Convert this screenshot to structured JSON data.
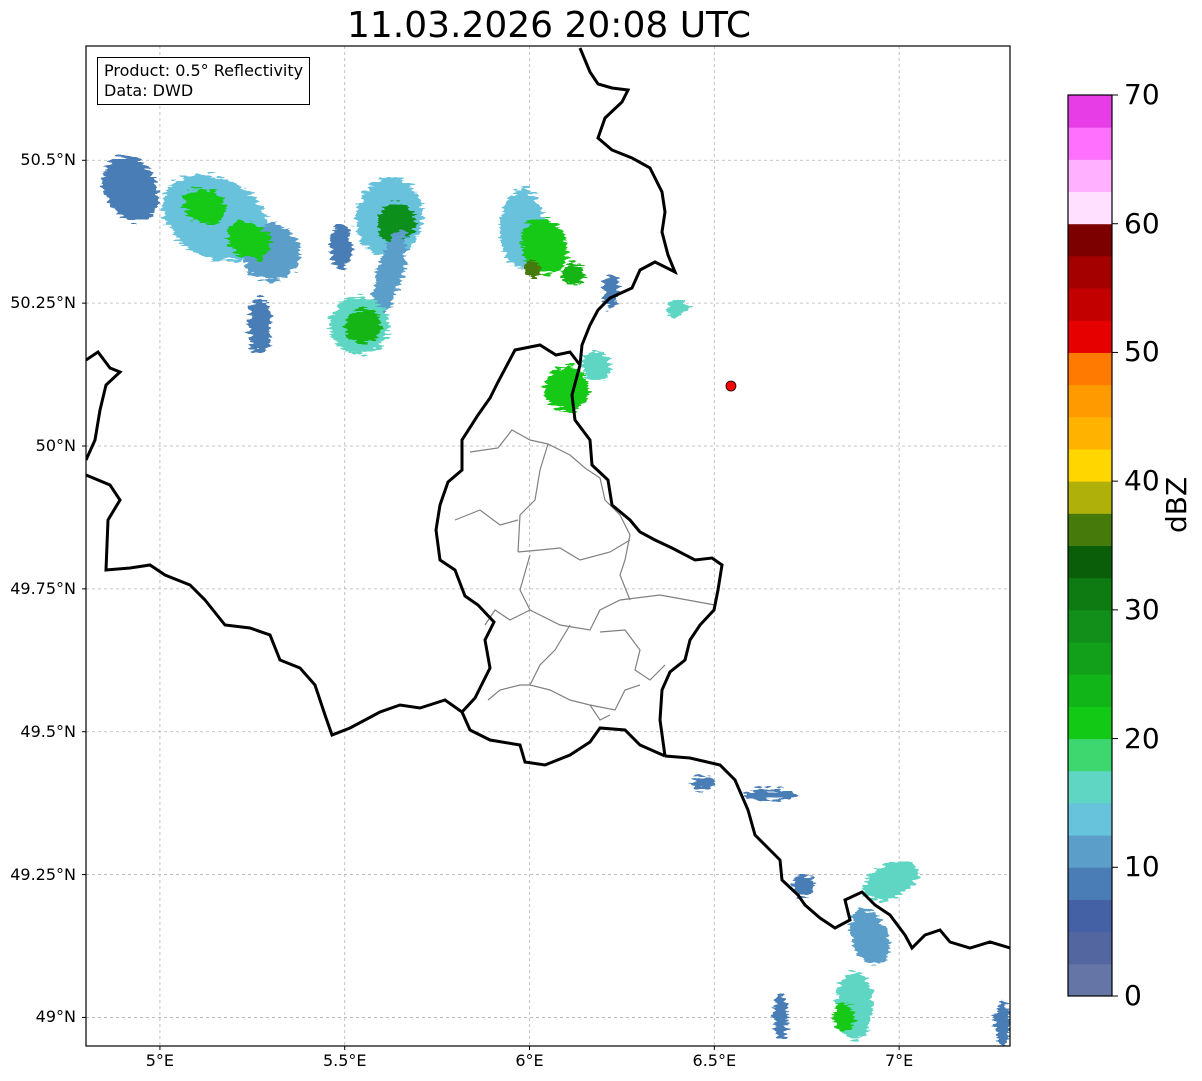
{
  "title": "11.03.2026 20:08 UTC",
  "info": {
    "product": "Product: 0.5° Reflectivity",
    "source": "Data: DWD"
  },
  "map": {
    "lon_range": [
      4.8,
      7.3
    ],
    "lat_range": [
      48.95,
      50.7
    ],
    "x_ticks": [
      {
        "value": 5.0,
        "label": "5°E"
      },
      {
        "value": 5.5,
        "label": "5.5°E"
      },
      {
        "value": 6.0,
        "label": "6°E"
      },
      {
        "value": 6.5,
        "label": "6.5°E"
      },
      {
        "value": 7.0,
        "label": "7°E"
      }
    ],
    "y_ticks": [
      {
        "value": 50.5,
        "label": "50.5°N"
      },
      {
        "value": 50.25,
        "label": "50.25°N"
      },
      {
        "value": 50.0,
        "label": "50°N"
      },
      {
        "value": 49.75,
        "label": "49.75°N"
      },
      {
        "value": 49.5,
        "label": "49.5°N"
      },
      {
        "value": 49.25,
        "label": "49.25°N"
      },
      {
        "value": 49.0,
        "label": "49°N"
      }
    ],
    "grid": true,
    "marker": {
      "lon": 6.545,
      "lat": 50.105,
      "color": "#ff0000"
    },
    "echo_cells": [
      {
        "lon": 4.92,
        "lat": 50.45,
        "rx": 0.07,
        "ry": 0.06,
        "angle": -25,
        "dbz": 9
      },
      {
        "lon": 5.15,
        "lat": 50.4,
        "rx": 0.15,
        "ry": 0.07,
        "angle": 25,
        "dbz": 14
      },
      {
        "lon": 5.3,
        "lat": 50.34,
        "rx": 0.08,
        "ry": 0.05,
        "angle": 20,
        "dbz": 12
      },
      {
        "lon": 5.12,
        "lat": 50.42,
        "rx": 0.06,
        "ry": 0.03,
        "angle": 25,
        "dbz": 22
      },
      {
        "lon": 5.24,
        "lat": 50.36,
        "rx": 0.06,
        "ry": 0.03,
        "angle": 25,
        "dbz": 20
      },
      {
        "lon": 5.27,
        "lat": 50.21,
        "rx": 0.03,
        "ry": 0.05,
        "angle": 0,
        "dbz": 9
      },
      {
        "lon": 5.62,
        "lat": 50.4,
        "rx": 0.09,
        "ry": 0.07,
        "angle": 10,
        "dbz": 14
      },
      {
        "lon": 5.64,
        "lat": 50.39,
        "rx": 0.05,
        "ry": 0.035,
        "angle": 10,
        "dbz": 28
      },
      {
        "lon": 5.62,
        "lat": 50.3,
        "rx": 0.035,
        "ry": 0.08,
        "angle": 15,
        "dbz": 12
      },
      {
        "lon": 5.54,
        "lat": 50.21,
        "rx": 0.08,
        "ry": 0.05,
        "angle": 0,
        "dbz": 16
      },
      {
        "lon": 5.55,
        "lat": 50.21,
        "rx": 0.05,
        "ry": 0.03,
        "angle": 0,
        "dbz": 24
      },
      {
        "lon": 5.49,
        "lat": 50.35,
        "rx": 0.03,
        "ry": 0.04,
        "angle": 0,
        "dbz": 8
      },
      {
        "lon": 5.98,
        "lat": 50.38,
        "rx": 0.06,
        "ry": 0.07,
        "angle": 0,
        "dbz": 14
      },
      {
        "lon": 6.04,
        "lat": 50.35,
        "rx": 0.06,
        "ry": 0.05,
        "angle": -20,
        "dbz": 22
      },
      {
        "lon": 6.01,
        "lat": 50.31,
        "rx": 0.02,
        "ry": 0.015,
        "angle": 0,
        "dbz": 36
      },
      {
        "lon": 6.12,
        "lat": 50.3,
        "rx": 0.03,
        "ry": 0.02,
        "angle": 0,
        "dbz": 24
      },
      {
        "lon": 6.22,
        "lat": 50.27,
        "rx": 0.02,
        "ry": 0.03,
        "angle": 0,
        "dbz": 8
      },
      {
        "lon": 6.4,
        "lat": 50.24,
        "rx": 0.03,
        "ry": 0.015,
        "angle": -20,
        "dbz": 15
      },
      {
        "lon": 6.1,
        "lat": 50.1,
        "rx": 0.06,
        "ry": 0.04,
        "angle": -20,
        "dbz": 20
      },
      {
        "lon": 6.18,
        "lat": 50.14,
        "rx": 0.04,
        "ry": 0.025,
        "angle": -30,
        "dbz": 16
      },
      {
        "lon": 6.47,
        "lat": 49.41,
        "rx": 0.035,
        "ry": 0.012,
        "angle": 0,
        "dbz": 8
      },
      {
        "lon": 6.65,
        "lat": 49.39,
        "rx": 0.07,
        "ry": 0.01,
        "angle": 0,
        "dbz": 8
      },
      {
        "lon": 6.74,
        "lat": 49.23,
        "rx": 0.03,
        "ry": 0.02,
        "angle": 0,
        "dbz": 9
      },
      {
        "lon": 6.98,
        "lat": 49.24,
        "rx": 0.08,
        "ry": 0.03,
        "angle": -25,
        "dbz": 16
      },
      {
        "lon": 6.92,
        "lat": 49.14,
        "rx": 0.05,
        "ry": 0.05,
        "angle": -20,
        "dbz": 12
      },
      {
        "lon": 6.88,
        "lat": 49.02,
        "rx": 0.05,
        "ry": 0.06,
        "angle": 0,
        "dbz": 15
      },
      {
        "lon": 6.85,
        "lat": 49.0,
        "rx": 0.03,
        "ry": 0.025,
        "angle": 0,
        "dbz": 22
      },
      {
        "lon": 6.68,
        "lat": 49.0,
        "rx": 0.02,
        "ry": 0.04,
        "angle": 0,
        "dbz": 8
      },
      {
        "lon": 7.28,
        "lat": 48.99,
        "rx": 0.02,
        "ry": 0.04,
        "angle": 0,
        "dbz": 9
      }
    ]
  },
  "colorbar": {
    "label": "dBZ",
    "range": [
      0,
      70
    ],
    "ticks": [
      {
        "value": 0,
        "label": "0"
      },
      {
        "value": 10,
        "label": "10"
      },
      {
        "value": 20,
        "label": "20"
      },
      {
        "value": 30,
        "label": "30"
      },
      {
        "value": 40,
        "label": "40"
      },
      {
        "value": 50,
        "label": "50"
      },
      {
        "value": 60,
        "label": "60"
      },
      {
        "value": 70,
        "label": "70"
      }
    ],
    "colors": [
      "#6575a6",
      "#5466a0",
      "#4561a6",
      "#4a7db5",
      "#5a9ec9",
      "#67c2dc",
      "#5fd6c3",
      "#3ed66e",
      "#12c916",
      "#12b518",
      "#12a01a",
      "#118f1a",
      "#0e7a12",
      "#0a5e0a",
      "#467a0a",
      "#b0b00a",
      "#ffd600",
      "#ffb300",
      "#ff9a00",
      "#ff7a00",
      "#e60000",
      "#c20000",
      "#a40000",
      "#7c0000",
      "#ffe0ff",
      "#ffb0ff",
      "#ff70ff",
      "#e63de6"
    ]
  }
}
